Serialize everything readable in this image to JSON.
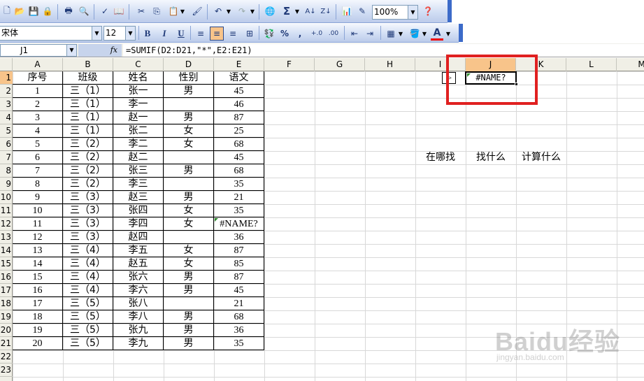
{
  "toolbar": {
    "zoom": "100%",
    "font_name": "宋体",
    "font_size": "12",
    "bold": "B",
    "italic": "I",
    "underline": "U",
    "percent": "%",
    "comma": ",",
    "sigma": "Σ",
    "font_color_letter": "A"
  },
  "formula_bar": {
    "name_box": "J1",
    "fx": "fx",
    "formula": "=SUMIF(D2:D21,\"*\",E2:E21)"
  },
  "columns": [
    "A",
    "B",
    "C",
    "D",
    "E",
    "F",
    "G",
    "H",
    "I",
    "J",
    "K",
    "L",
    "M"
  ],
  "rows": [
    "1",
    "2",
    "3",
    "4",
    "5",
    "6",
    "7",
    "8",
    "9",
    "10",
    "11",
    "12",
    "13",
    "14",
    "15",
    "16",
    "17",
    "18",
    "19",
    "20",
    "21",
    "22",
    "23"
  ],
  "table": {
    "headers": [
      "序号",
      "班级",
      "姓名",
      "性别",
      "语文"
    ],
    "data": [
      [
        "1",
        "三（1）",
        "张一",
        "男",
        "45"
      ],
      [
        "2",
        "三（1）",
        "李一",
        "",
        "46"
      ],
      [
        "3",
        "三（1）",
        "赵一",
        "男",
        "87"
      ],
      [
        "4",
        "三（1）",
        "张二",
        "女",
        "25"
      ],
      [
        "5",
        "三（2）",
        "李二",
        "女",
        "68"
      ],
      [
        "6",
        "三（2）",
        "赵二",
        "",
        "45"
      ],
      [
        "7",
        "三（2）",
        "张三",
        "男",
        "68"
      ],
      [
        "8",
        "三（2）",
        "李三",
        "",
        "35"
      ],
      [
        "9",
        "三（3）",
        "赵三",
        "男",
        "21"
      ],
      [
        "10",
        "三（3）",
        "张四",
        "女",
        "35"
      ],
      [
        "11",
        "三（3）",
        "李四",
        "女",
        "#NAME?"
      ],
      [
        "12",
        "三（3）",
        "赵四",
        "",
        "36"
      ],
      [
        "13",
        "三（4）",
        "李五",
        "女",
        "87"
      ],
      [
        "14",
        "三（4）",
        "赵五",
        "女",
        "85"
      ],
      [
        "15",
        "三（4）",
        "张六",
        "男",
        "87"
      ],
      [
        "16",
        "三（4）",
        "李六",
        "男",
        "45"
      ],
      [
        "17",
        "三（5）",
        "张八",
        "",
        "21"
      ],
      [
        "18",
        "三（5）",
        "李八",
        "男",
        "68"
      ],
      [
        "19",
        "三（5）",
        "张九",
        "男",
        "36"
      ],
      [
        "20",
        "三（5）",
        "李九",
        "男",
        "35"
      ]
    ]
  },
  "selected_cell_value": "#NAME?",
  "small_box": "▷",
  "labels": {
    "where": "在哪找",
    "what": "找什么",
    "calc": "计算什么"
  },
  "watermark": {
    "brand": "Baidu经验",
    "sub": "jingyan.baidu.com"
  },
  "colors": {
    "highlight_red": "#e02020",
    "active_header": "#f8c48a",
    "toolbar_blue": "#cfdcf3"
  }
}
